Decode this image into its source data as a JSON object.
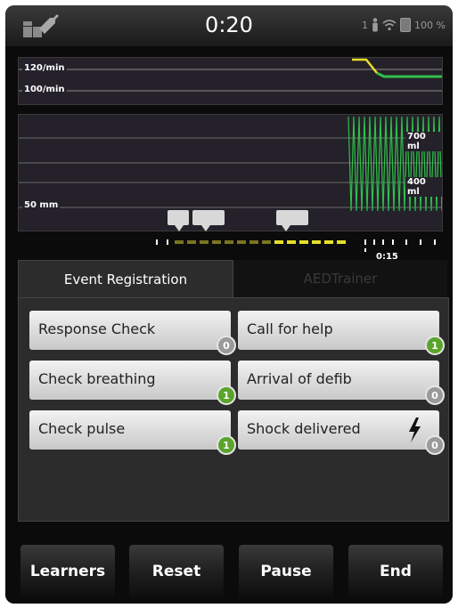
{
  "status_bar": {
    "timer": "0:20",
    "notification_count": "1",
    "battery": "100 %"
  },
  "rate_chart": {
    "labels": [
      "120/min",
      "100/min"
    ]
  },
  "volume_chart": {
    "labels": [
      "700 ml",
      "400 ml",
      "50 mm"
    ]
  },
  "timeline": {
    "time_label": "0:15"
  },
  "tabs": [
    {
      "label": "Event Registration",
      "active": true
    },
    {
      "label": "AEDTrainer",
      "active": false
    }
  ],
  "events": [
    {
      "label": "Response Check",
      "count": "0"
    },
    {
      "label": "Call for help",
      "count": "1"
    },
    {
      "label": "Check breathing",
      "count": "1"
    },
    {
      "label": "Arrival of defib",
      "count": "0"
    },
    {
      "label": "Check pulse",
      "count": "1"
    },
    {
      "label": "Shock delivered",
      "count": "0",
      "icon": "lightning-icon"
    }
  ],
  "footer": {
    "learners": "Learners",
    "reset": "Reset",
    "pause": "Pause",
    "end": "End"
  },
  "colors": {
    "badge_active": "#5aa42c",
    "badge_inactive": "#9a9a9a",
    "waveform": "#2fbf4a",
    "timeline_active": "#e6df2a"
  }
}
